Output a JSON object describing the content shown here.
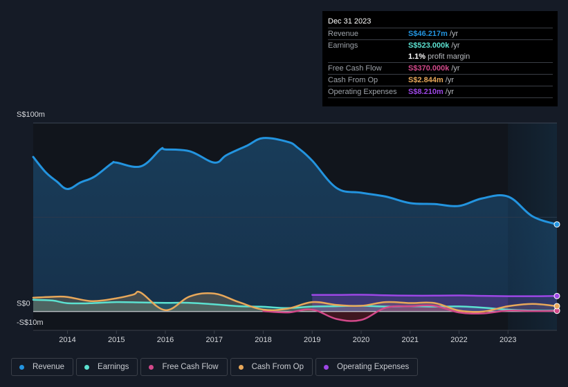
{
  "tooltip": {
    "date": "Dec 31 2023",
    "rows": [
      {
        "label": "Revenue",
        "value": "S$46.217m",
        "suffix": "/yr",
        "color": "#2394df"
      },
      {
        "label": "Earnings",
        "value": "S$523.000k",
        "suffix": "/yr",
        "color": "#5ce1d0"
      },
      {
        "label": "",
        "value": "1.1%",
        "suffix": "profit margin",
        "color": "#ffffff"
      },
      {
        "label": "Free Cash Flow",
        "value": "S$370.000k",
        "suffix": "/yr",
        "color": "#d2498a"
      },
      {
        "label": "Cash From Op",
        "value": "S$2.844m",
        "suffix": "/yr",
        "color": "#e8a85a"
      },
      {
        "label": "Operating Expenses",
        "value": "S$8.210m",
        "suffix": "/yr",
        "color": "#9d47e6"
      }
    ]
  },
  "legend": [
    {
      "label": "Revenue",
      "color": "#2394df"
    },
    {
      "label": "Earnings",
      "color": "#5ce1d0"
    },
    {
      "label": "Free Cash Flow",
      "color": "#d2498a"
    },
    {
      "label": "Cash From Op",
      "color": "#e8a85a"
    },
    {
      "label": "Operating Expenses",
      "color": "#9d47e6"
    }
  ],
  "chart_data": {
    "type": "area",
    "title": "",
    "xlabel": "",
    "ylabel": "",
    "currency_unit": "S$ millions",
    "ylim": [
      -10,
      100
    ],
    "xlim": [
      2013.3,
      2024.0
    ],
    "y_ticks": [
      {
        "value": 100,
        "label": "S$100m"
      },
      {
        "value": 0,
        "label": "S$0"
      },
      {
        "value": -10,
        "label": "-S$10m"
      }
    ],
    "x_ticks": [
      {
        "value": 2014,
        "label": "2014"
      },
      {
        "value": 2015,
        "label": "2015"
      },
      {
        "value": 2016,
        "label": "2016"
      },
      {
        "value": 2017,
        "label": "2017"
      },
      {
        "value": 2018,
        "label": "2018"
      },
      {
        "value": 2019,
        "label": "2019"
      },
      {
        "value": 2020,
        "label": "2020"
      },
      {
        "value": 2021,
        "label": "2021"
      },
      {
        "value": 2022,
        "label": "2022"
      },
      {
        "value": 2023,
        "label": "2023"
      }
    ],
    "highlight_range": [
      2023.0,
      2024.0
    ],
    "legend_position": "bottom",
    "grid": true,
    "series": [
      {
        "name": "Revenue",
        "color": "#2394df",
        "x": [
          2013.3,
          2013.55,
          2013.78,
          2014.0,
          2014.27,
          2014.55,
          2014.9,
          2015.0,
          2015.5,
          2015.9,
          2016.0,
          2016.5,
          2017.0,
          2017.25,
          2017.67,
          2018.0,
          2018.5,
          2018.7,
          2019.0,
          2019.5,
          2020.0,
          2020.5,
          2021.0,
          2021.5,
          2022.0,
          2022.47,
          2023.0,
          2023.5,
          2024.0
        ],
        "values": [
          82,
          74,
          69,
          65,
          68.5,
          71.5,
          78.5,
          79,
          77,
          86,
          86,
          85,
          79,
          83,
          88,
          92,
          90,
          87,
          80,
          65.5,
          63,
          61,
          57.5,
          57,
          56,
          60,
          61,
          50.5,
          46.2
        ]
      },
      {
        "name": "Earnings",
        "color": "#5ce1d0",
        "x": [
          2013.3,
          2013.7,
          2014.0,
          2014.5,
          2015.0,
          2015.5,
          2016.0,
          2016.5,
          2017.0,
          2017.5,
          2018.0,
          2018.5,
          2019.0,
          2019.5,
          2020.0,
          2020.5,
          2021.0,
          2021.5,
          2022.0,
          2022.5,
          2023.0,
          2023.5,
          2024.0
        ],
        "values": [
          6.2,
          5.8,
          4.4,
          4.4,
          5.0,
          4.8,
          4.6,
          4.6,
          3.8,
          2.8,
          2.5,
          1.8,
          2.6,
          2.8,
          3.0,
          2.6,
          2.8,
          2.6,
          2.7,
          2.0,
          1.0,
          0.5,
          0.52
        ]
      },
      {
        "name": "Free Cash Flow",
        "color": "#d2498a",
        "x": [
          2018.0,
          2018.5,
          2019.0,
          2019.5,
          2020.0,
          2020.5,
          2021.0,
          2021.5,
          2022.0,
          2022.5,
          2023.0,
          2023.5,
          2024.0
        ],
        "values": [
          0.2,
          -0.5,
          1.0,
          -4.0,
          -4.5,
          2.0,
          2.8,
          3.0,
          -0.5,
          -1.0,
          0.5,
          0.2,
          0.37
        ]
      },
      {
        "name": "Cash From Op",
        "color": "#e8a85a",
        "x": [
          2013.3,
          2013.7,
          2014.0,
          2014.5,
          2015.0,
          2015.35,
          2015.5,
          2016.0,
          2016.5,
          2017.0,
          2017.5,
          2018.0,
          2018.5,
          2019.0,
          2019.5,
          2020.0,
          2020.5,
          2021.0,
          2021.5,
          2022.0,
          2022.5,
          2023.0,
          2023.5,
          2024.0
        ],
        "values": [
          7.3,
          7.8,
          7.7,
          5.5,
          7.0,
          9.0,
          10.0,
          0.7,
          8.0,
          9.5,
          5.0,
          1.0,
          1.5,
          5.0,
          3.5,
          3.0,
          5.0,
          4.5,
          4.5,
          0.5,
          0.0,
          2.8,
          4.0,
          2.84
        ]
      },
      {
        "name": "Operating Expenses",
        "color": "#9d47e6",
        "x": [
          2019.0,
          2019.5,
          2020.0,
          2020.5,
          2021.0,
          2021.5,
          2022.0,
          2022.5,
          2023.0,
          2023.5,
          2024.0
        ],
        "values": [
          8.8,
          8.8,
          8.9,
          8.6,
          8.4,
          8.4,
          8.5,
          8.3,
          8.1,
          8.1,
          8.21
        ]
      }
    ]
  }
}
